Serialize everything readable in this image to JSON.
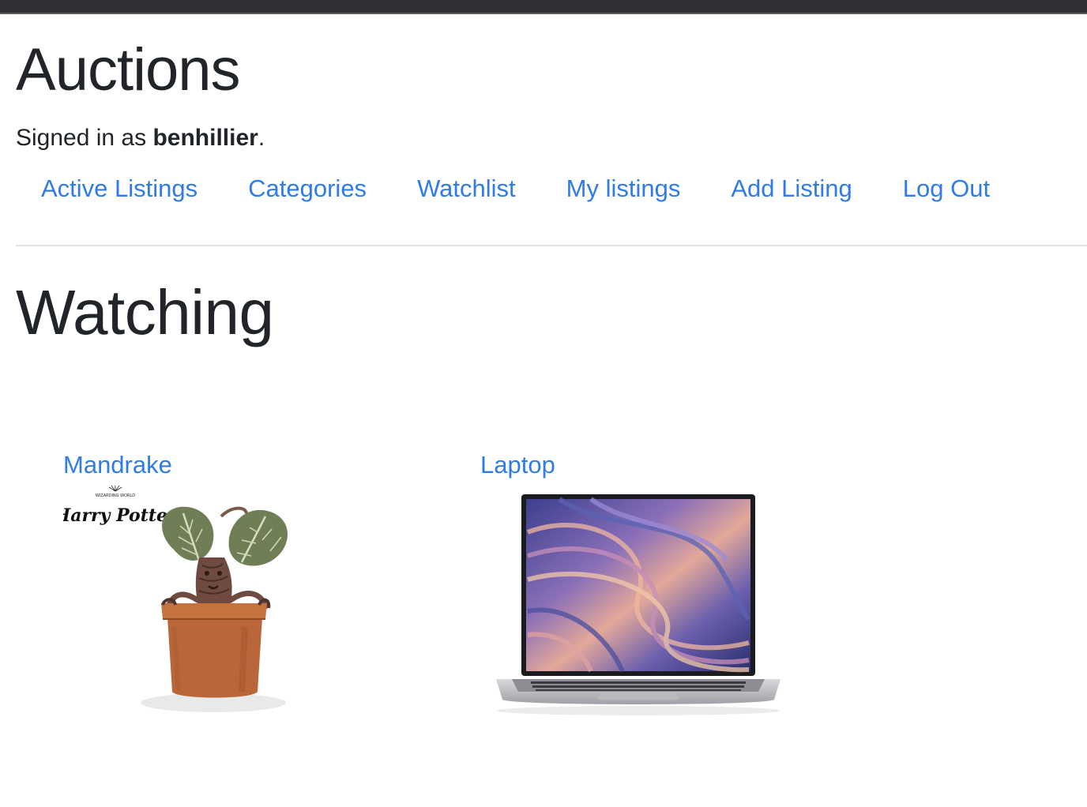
{
  "site": {
    "title": "Auctions",
    "signed_in_prefix": "Signed in as ",
    "username": "benhillier",
    "signed_in_suffix": "."
  },
  "nav": {
    "items": [
      {
        "label": "Active Listings"
      },
      {
        "label": "Categories"
      },
      {
        "label": "Watchlist"
      },
      {
        "label": "My listings"
      },
      {
        "label": "Add Listing"
      },
      {
        "label": "Log Out"
      }
    ]
  },
  "main": {
    "heading": "Watching",
    "listings": [
      {
        "title": "Mandrake",
        "image": "mandrake-plant-image",
        "logo_small": "WIZARDING WORLD",
        "logo_text": "Harry Potter"
      },
      {
        "title": "Laptop",
        "image": "laptop-image"
      }
    ]
  },
  "colors": {
    "link": "#2f7bea",
    "text": "#212529",
    "topbar": "#2f3033",
    "divider": "#dfe1e3"
  }
}
